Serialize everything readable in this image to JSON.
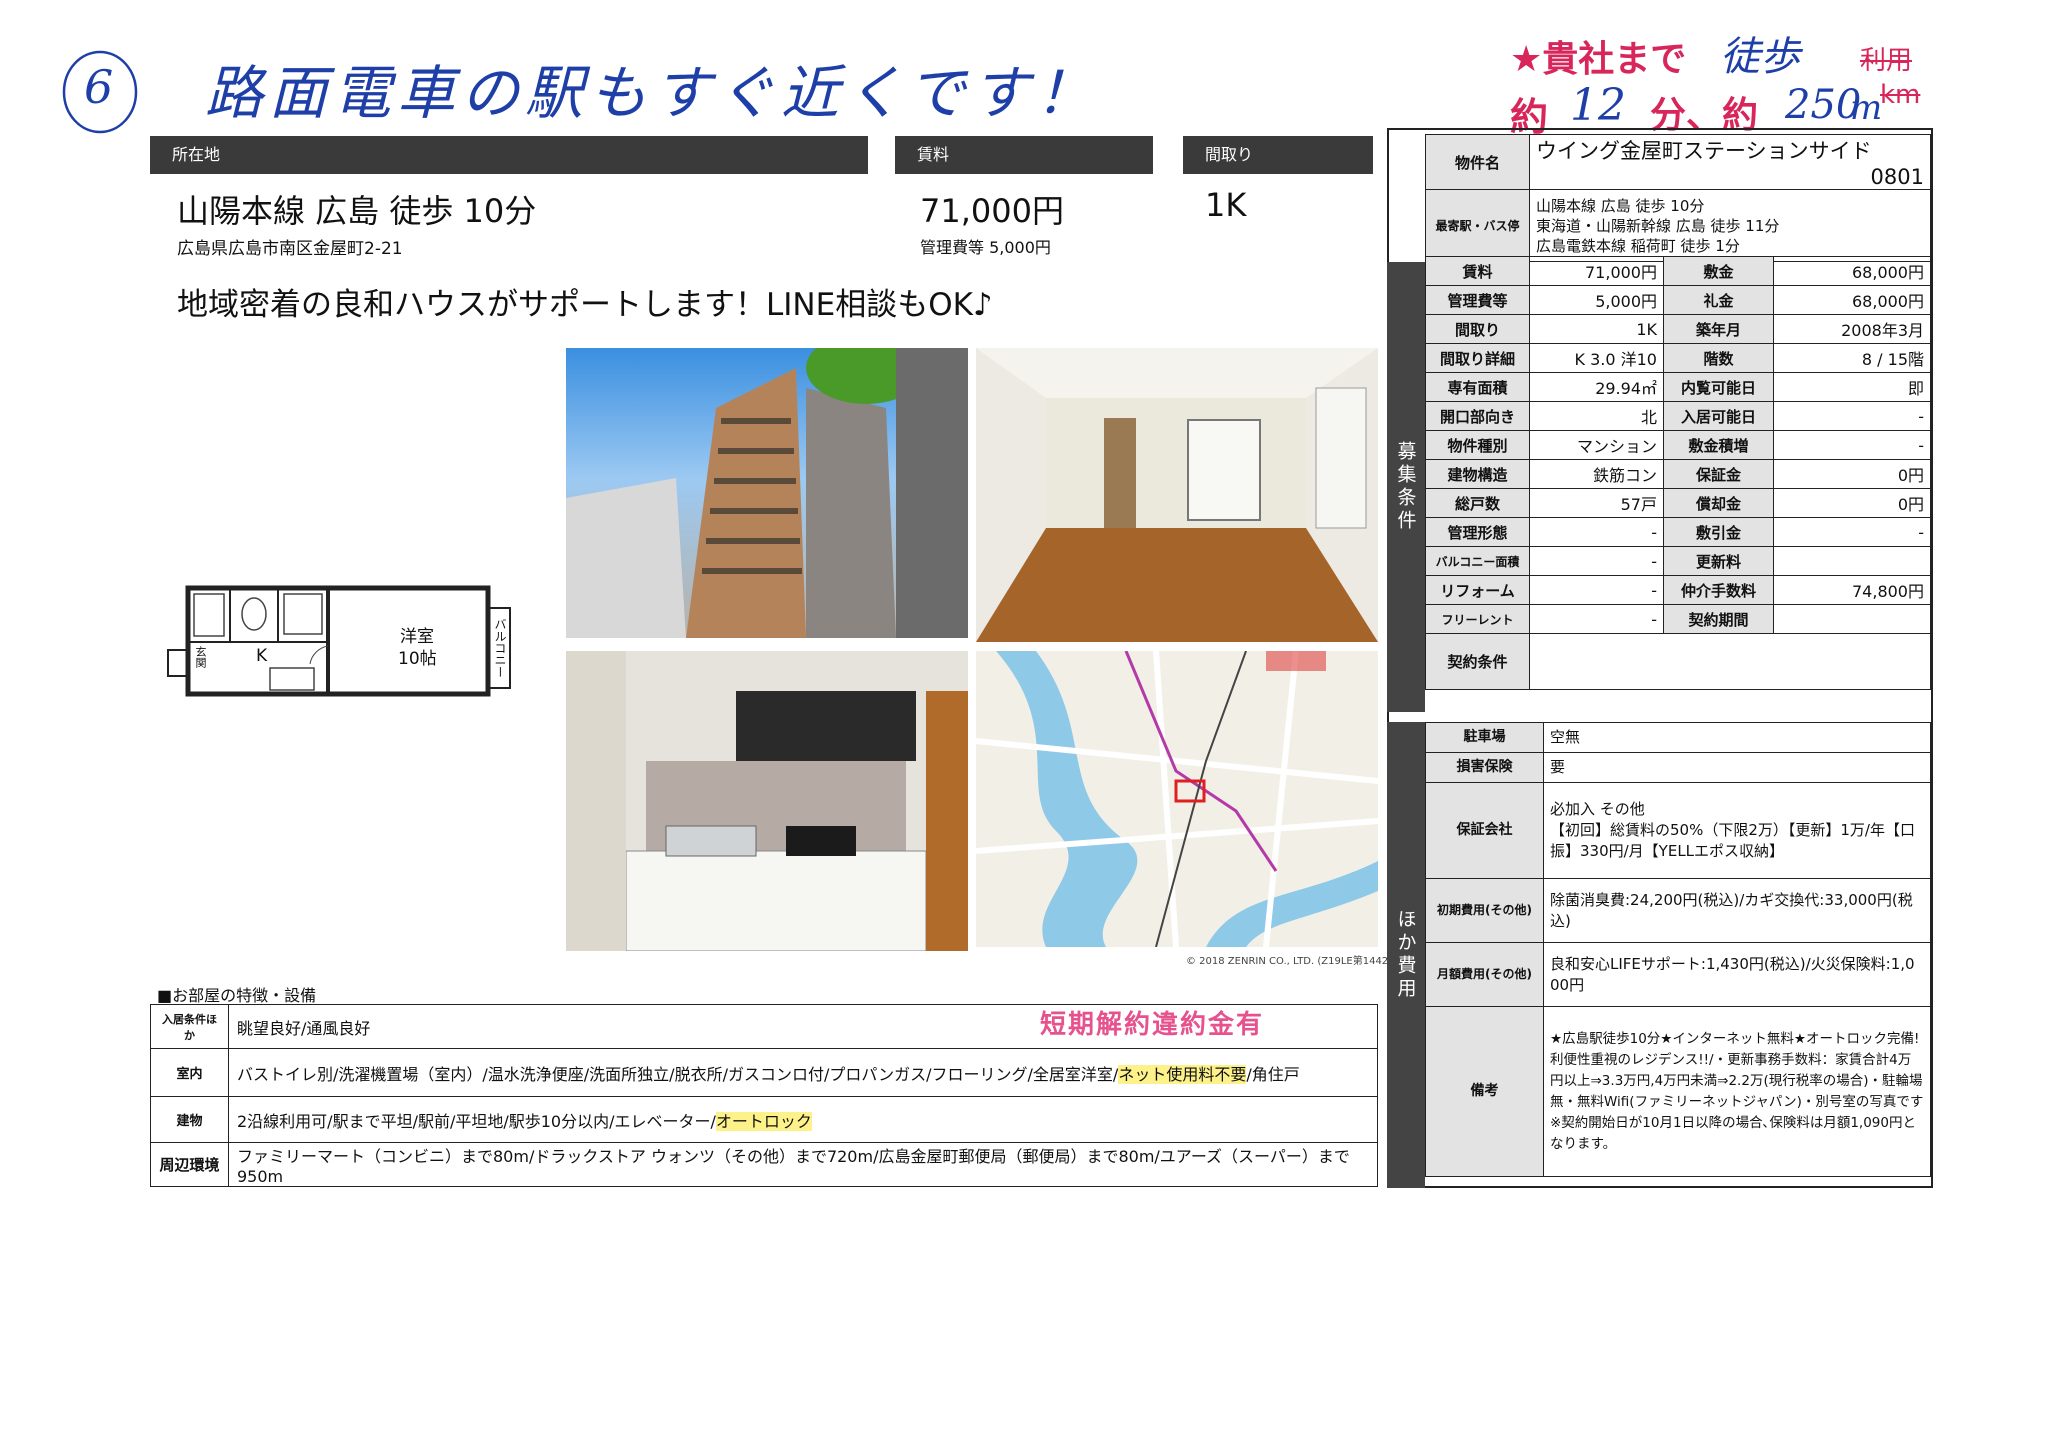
{
  "handwriting": {
    "number": "6",
    "note": "路面電車の駅もすぐ近くです！",
    "stamp_line1": "★貴社まで",
    "stamp_line2": "約",
    "stamp_min": "分、約",
    "stamp_m": "m",
    "walk": "徒歩",
    "walk_minutes": "12",
    "walk_meters": "250",
    "crossed_1": "利用",
    "crossed_2": "km"
  },
  "headers": {
    "location": "所在地",
    "rent": "賃料",
    "layout": "間取り"
  },
  "summary": {
    "access": "山陽本線 広島 徒歩 10分",
    "address": "広島県広島市南区金屋町2-21",
    "rent": "71,000円",
    "mgmt_fee": "管理費等 5,000円",
    "layout": "1K",
    "catch": "地域密着の良和ハウスがサポートします！LINE相談もOK♪"
  },
  "floorplan": {
    "room": "洋室",
    "room_size": "10帖",
    "kitchen": "K",
    "balcony": "バルコニー",
    "entrance": "玄関"
  },
  "map": {
    "credit": "© 2018 ZENRIN CO., LTD. (Z19LE第1442号)"
  },
  "features": {
    "title": "■お部屋の特徴・設備",
    "rows": [
      {
        "label": "入居条件ほか",
        "text": "眺望良好/通風良好"
      },
      {
        "label": "室内",
        "pre": "バストイレ別/洗濯機置場（室内）/温水洗浄便座/洗面所独立/脱衣所/ガスコンロ付/プロパンガス/フローリング/全居室洋室/",
        "hl": "ネット使用料不要",
        "post": "/角住戸"
      },
      {
        "label": "建物",
        "pre": "2沿線利用可/駅まで平坦/駅前/平坦地/駅歩10分以内/エレベーター/",
        "hl": "オートロック",
        "post": ""
      },
      {
        "label": "周辺環境",
        "text": "ファミリーマート（コンビニ）まで80m/ドラックストア ウォンツ（その他）まで720m/広島金屋町郵便局（郵便局）まで80m/ユアーズ（スーパー）まで950m"
      }
    ],
    "stamp": "短期解約違約金有"
  },
  "property": {
    "name_label": "物件名",
    "name": "ウイング金屋町ステーションサイド",
    "room_no": "0801",
    "station_label": "最寄駅・バス停",
    "stations": [
      "山陽本線 広島 徒歩 10分",
      "東海道・山陽新幹線 広島 徒歩 11分",
      "広島電鉄本線 稲荷町 徒歩 1分"
    ]
  },
  "conditions": {
    "side_label": "募集条件",
    "rows": [
      [
        "賃料",
        "71,000円",
        "敷金",
        "68,000円"
      ],
      [
        "管理費等",
        "5,000円",
        "礼金",
        "68,000円"
      ],
      [
        "間取り",
        "1K",
        "築年月",
        "2008年3月"
      ],
      [
        "間取り詳細",
        "K 3.0 洋10",
        "階数",
        "8 / 15階"
      ],
      [
        "専有面積",
        "29.94㎡",
        "内覧可能日",
        "即"
      ],
      [
        "開口部向き",
        "北",
        "入居可能日",
        "-"
      ],
      [
        "物件種別",
        "マンション",
        "敷金積増",
        "-"
      ],
      [
        "建物構造",
        "鉄筋コン",
        "保証金",
        "0円"
      ],
      [
        "総戸数",
        "57戸",
        "償却金",
        "0円"
      ],
      [
        "管理形態",
        "-",
        "敷引金",
        "-"
      ],
      [
        "バルコニー面積",
        "-",
        "更新料",
        ""
      ],
      [
        "リフォーム",
        "-",
        "仲介手数料",
        "74,800円"
      ],
      [
        "フリーレント",
        "-",
        "契約期間",
        ""
      ]
    ],
    "contract_label": "契約条件",
    "contract_value": ""
  },
  "other": {
    "side_label": "ほか費用",
    "rows": [
      {
        "label": "駐車場",
        "value": "空無"
      },
      {
        "label": "損害保険",
        "value": "要"
      },
      {
        "label": "保証会社",
        "value": "必加入 その他\n【初回】総賃料の50%（下限2万）【更新】1万/年【口振】330円/月【YELLエポス収納】"
      },
      {
        "label": "初期費用(その他)",
        "value": "除菌消臭費:24,200円(税込)/カギ交換代:33,000円(税込)"
      },
      {
        "label": "月額費用(その他)",
        "value": "良和安心LIFEサポート:1,430円(税込)/火災保険料:1,000円"
      },
      {
        "label": "備考",
        "value": "★広島駅徒歩10分★インターネット無料★オートロック完備!利便性重視のレジデンス!!/・更新事務手数料：家賃合計4万円以上⇒3.3万円,4万円未満⇒2.2万(現行税率の場合)・駐輪場無・無料Wifi(ファミリーネットジャパン)・別号室の写真です※契約開始日が10月1日以降の場合､保険料は月額1,090円となります。"
      }
    ]
  }
}
